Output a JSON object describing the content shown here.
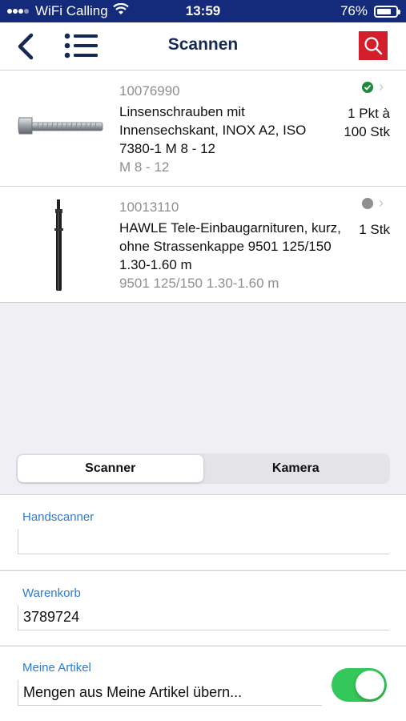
{
  "status_bar": {
    "carrier": "WiFi Calling",
    "time": "13:59",
    "battery": "76%",
    "battery_level": 0.76
  },
  "nav": {
    "title": "Scannen",
    "back_icon": "chevron-left-icon",
    "menu_icon": "list-icon",
    "search_icon": "search-icon"
  },
  "items": [
    {
      "number": "10076990",
      "description": "Linsenschrauben mit Innensechskant, INOX A2, ISO 7380-1 M 8 - 12",
      "sub": "M 8 - 12",
      "quantity": "1 Pkt à 100 Stk",
      "status_color": "#1f8a3a"
    },
    {
      "number": "10013110",
      "description": "HAWLE Tele-Einbaugarnituren, kurz, ohne Strassenkappe 9501 125/150  1.30-1.60 m",
      "sub": "9501  125/150  1.30-1.60 m",
      "quantity": "1 Stk",
      "status_color": "#8e8e93"
    }
  ],
  "segment": {
    "scanner": "Scanner",
    "kamera": "Kamera",
    "selected": "Scanner"
  },
  "form": {
    "handscanner_label": "Handscanner",
    "handscanner_value": "",
    "warenkorb_label": "Warenkorb",
    "warenkorb_value": "3789724",
    "meine_artikel_label": "Meine Artikel",
    "meine_artikel_text": "Mengen aus Meine Artikel übern...",
    "meine_artikel_toggle": true
  },
  "colors": {
    "status_bar": "#142a7a",
    "accent_red": "#d21f2b",
    "label_blue": "#2f7bd1",
    "toggle_green": "#34c759"
  }
}
